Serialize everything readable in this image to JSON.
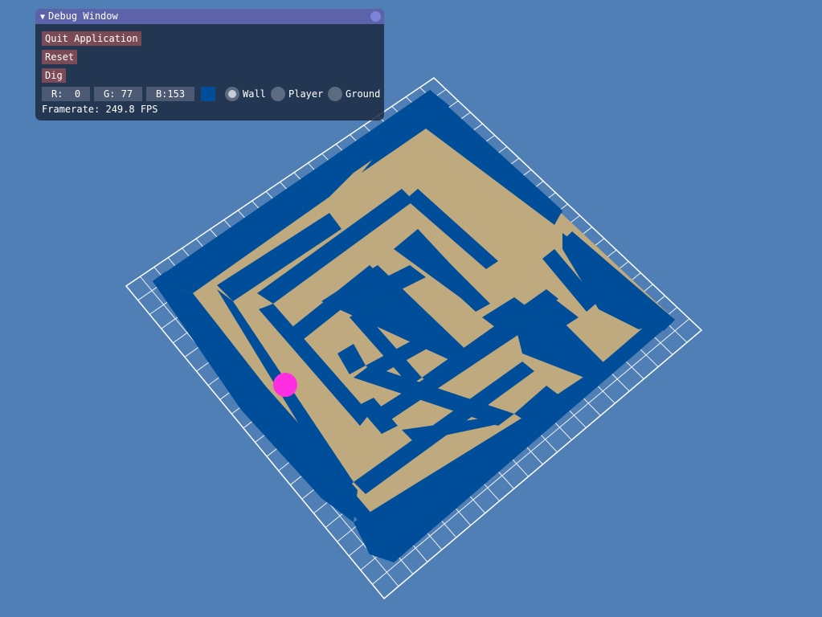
{
  "debug_window": {
    "title": "Debug Window",
    "buttons": {
      "quit": "Quit Application",
      "reset": "Reset",
      "dig": "Dig"
    },
    "color_fields": {
      "r": "R:  0",
      "g": "G: 77",
      "b": "B:153"
    },
    "swatch_color": "#004d99",
    "radio_options": [
      {
        "label": "Wall",
        "selected": true
      },
      {
        "label": "Player",
        "selected": false
      },
      {
        "label": "Ground",
        "selected": false
      }
    ],
    "framerate": "Framerate: 249.8 FPS"
  },
  "scene": {
    "background_color": "#4f7fb4",
    "wall_color": "#004d99",
    "ground_color": "#bfaa80",
    "player_color": "#ff2ee0",
    "grid_line_color": "#ffffff"
  }
}
